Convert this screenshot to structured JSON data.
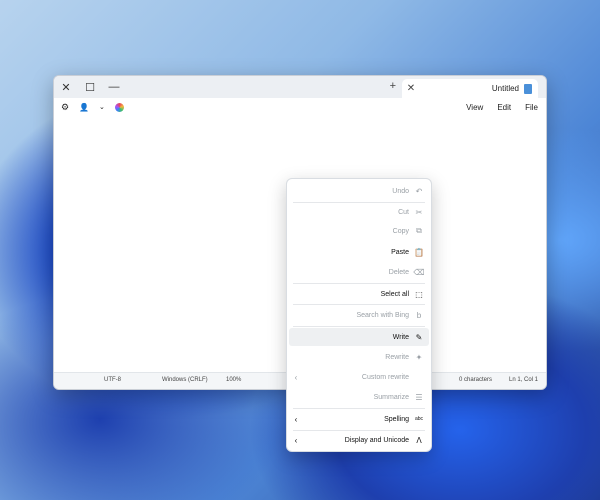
{
  "window": {
    "tab_title": "Untitled",
    "tab_close": "✕",
    "new_tab": "+",
    "controls": {
      "close": "✕",
      "maximize": "☐",
      "minimize": "—"
    }
  },
  "menubar": {
    "file": "File",
    "edit": "Edit",
    "view": "View"
  },
  "statusbar": {
    "position": "Ln 1, Col 1",
    "characters": "0 characters",
    "zoom": "100%",
    "line_ending": "Windows (CRLF)",
    "encoding": "UTF-8"
  },
  "context_menu": {
    "items": [
      {
        "label": "Undo",
        "icon": "↶"
      },
      {
        "label": "Cut",
        "icon": "✂"
      },
      {
        "label": "Copy",
        "icon": "⧉"
      },
      {
        "label": "Paste",
        "icon": "📋"
      },
      {
        "label": "Delete",
        "icon": "⌫"
      },
      {
        "label": "Select all",
        "icon": "⬚"
      },
      {
        "label": "Search with Bing",
        "icon": "b"
      },
      {
        "label": "Write",
        "icon": "✎"
      },
      {
        "label": "Rewrite",
        "icon": "✦"
      },
      {
        "label": "Custom rewrite",
        "icon": "",
        "chevron": "‹"
      },
      {
        "label": "Summarize",
        "icon": "☰"
      },
      {
        "label": "Spelling",
        "icon": "abc",
        "chevron": "‹"
      },
      {
        "label": "Display and Unicode",
        "icon": "Ʌ",
        "chevron": "‹"
      }
    ]
  }
}
